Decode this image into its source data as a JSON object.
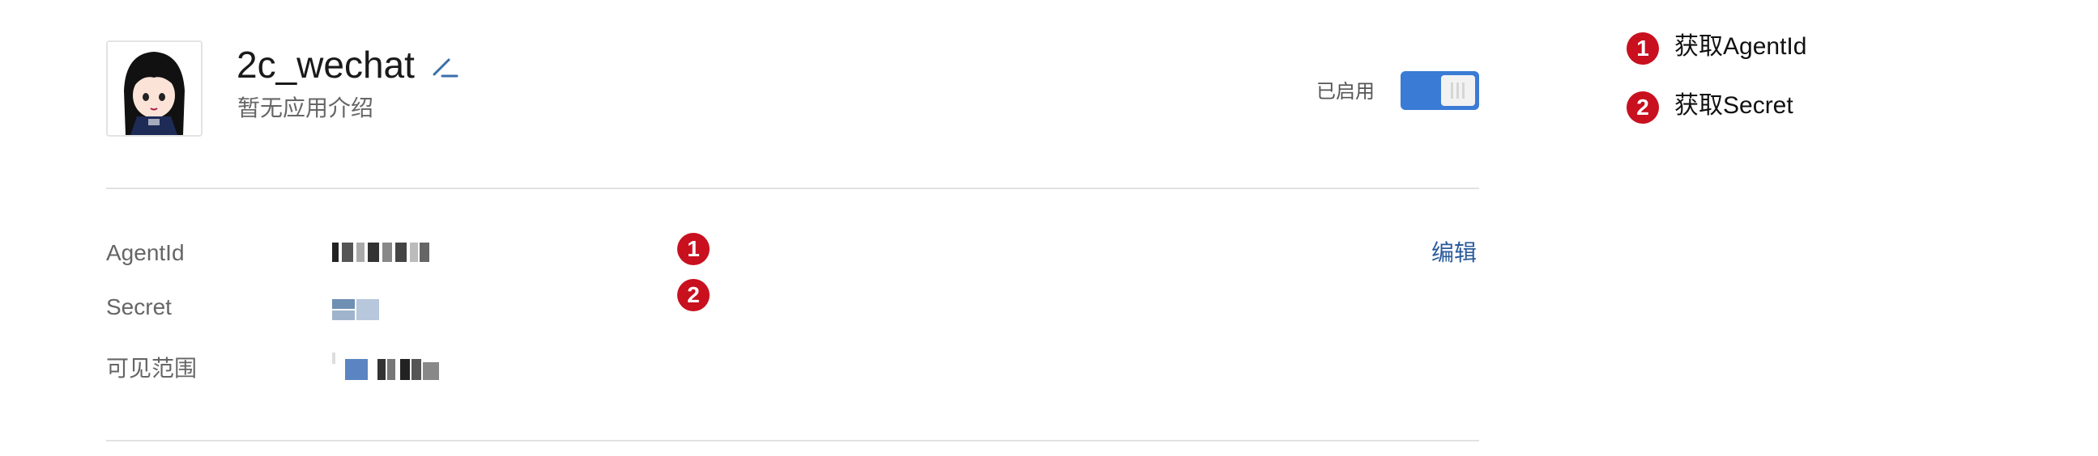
{
  "app": {
    "name": "2c_wechat",
    "description": "暂无应用介绍",
    "status_label": "已启用",
    "toggle_on": true
  },
  "info": {
    "rows": [
      {
        "label": "AgentId",
        "value_masked": true
      },
      {
        "label": "Secret",
        "value_masked": true
      },
      {
        "label": "可见范围",
        "value_masked": true
      }
    ],
    "edit_label": "编辑"
  },
  "markers": [
    {
      "number": "1"
    },
    {
      "number": "2"
    }
  ],
  "legend": [
    {
      "number": "1",
      "text": "获取AgentId"
    },
    {
      "number": "2",
      "text": "获取Secret"
    }
  ],
  "colors": {
    "accent": "#3a7bd5",
    "badge": "#c8101f",
    "link": "#2a5b9c",
    "divider": "#e2e2e2"
  }
}
